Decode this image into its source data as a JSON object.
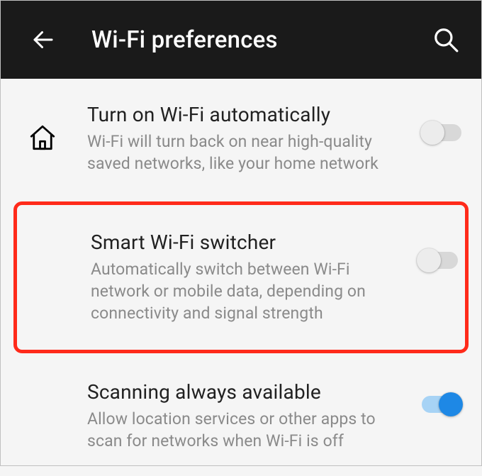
{
  "header": {
    "title": "Wi-Fi preferences"
  },
  "settings": [
    {
      "title": "Turn on Wi-Fi automatically",
      "desc": "Wi-Fi will turn back on near high-quality saved networks, like your home network",
      "toggle_on": false,
      "icon": "home-icon"
    },
    {
      "title": "Smart Wi-Fi switcher",
      "desc": "Automatically switch between Wi-Fi network or mobile data, depending on connectivity and signal strength",
      "toggle_on": false,
      "highlighted": true
    },
    {
      "title": "Scanning always available",
      "desc": "Allow location services or other apps to scan for networks when Wi-Fi is off",
      "toggle_on": true
    }
  ]
}
